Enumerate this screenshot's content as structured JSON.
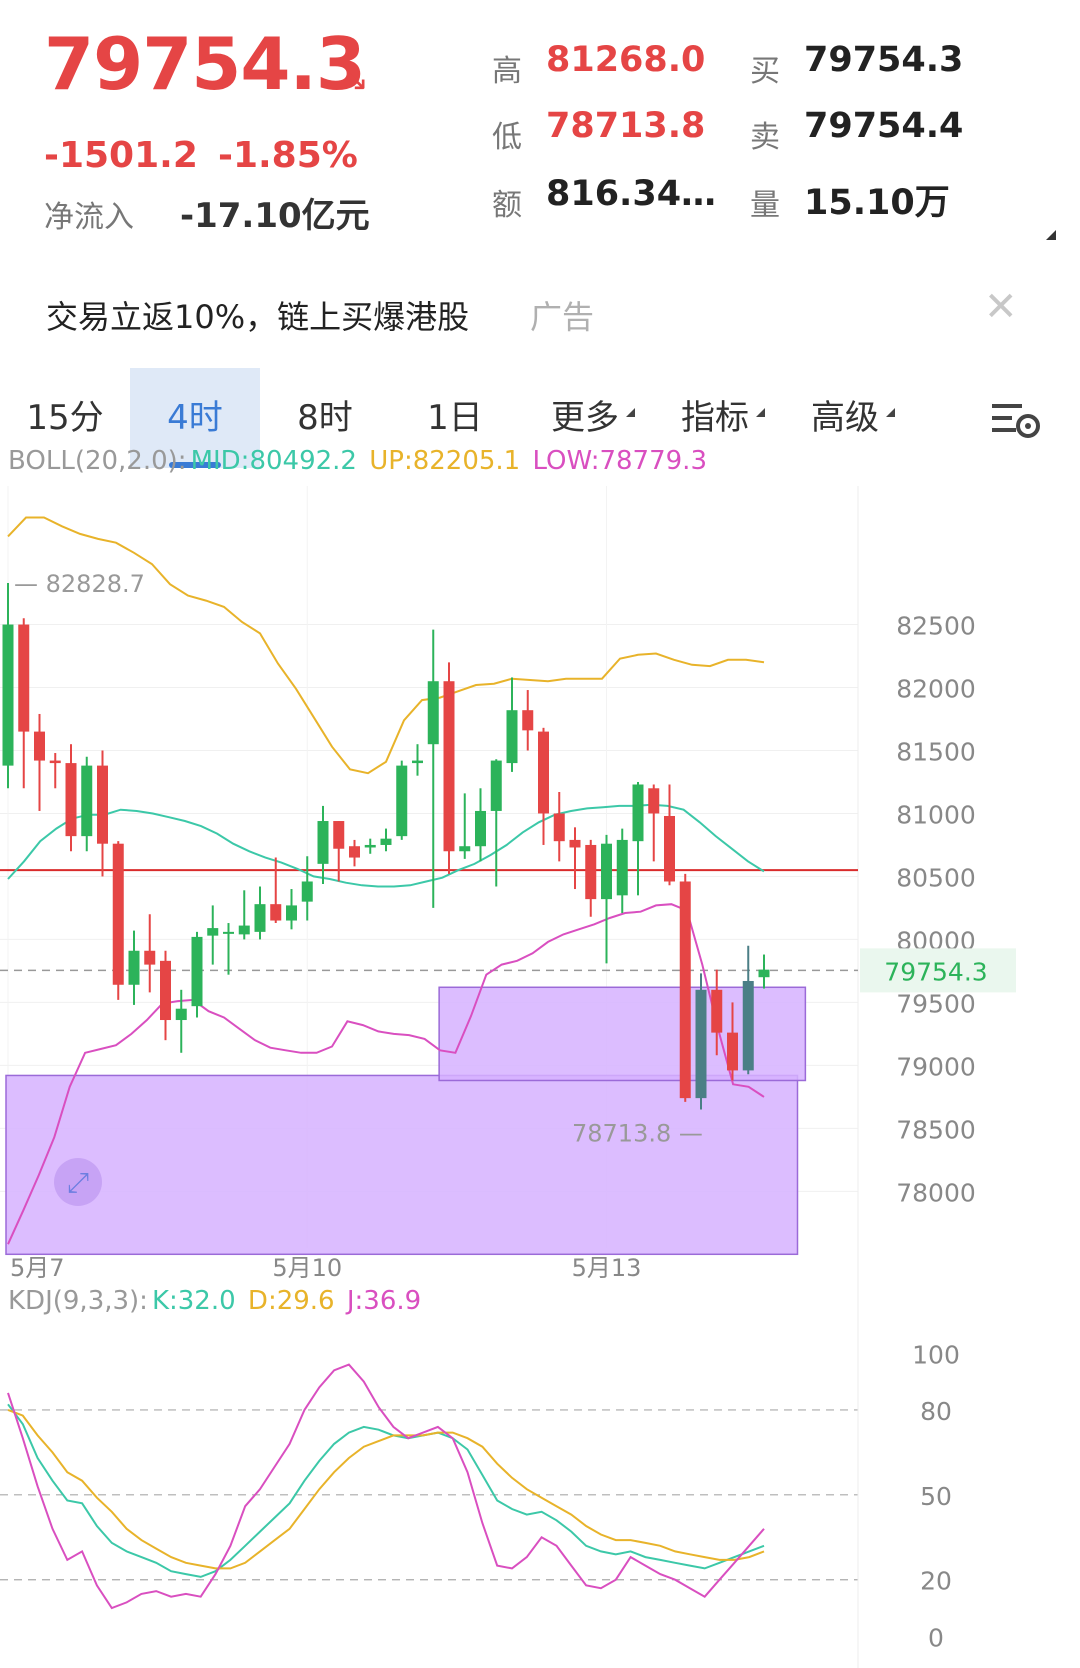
{
  "quote": {
    "price": "79754.3",
    "change": "-1501.2",
    "change_pct": "-1.85%",
    "net_inflow_label": "净流入",
    "net_inflow_value": "-17.10亿元",
    "high_label": "高",
    "high_value": "81268.0",
    "low_label": "低",
    "low_value": "78713.8",
    "amount_label": "额",
    "amount_value": "816.34…",
    "bid_label": "买",
    "bid_value": "79754.3",
    "ask_label": "卖",
    "ask_value": "79754.4",
    "volume_label": "量",
    "volume_value": "15.10万"
  },
  "ad": {
    "text": "交易立返10%，链上买爆港股",
    "tag": "广告"
  },
  "tabs": [
    {
      "label": "15分"
    },
    {
      "label": "4时"
    },
    {
      "label": "8时"
    },
    {
      "label": "1日"
    },
    {
      "label": "更多"
    },
    {
      "label": "指标"
    },
    {
      "label": "高级"
    }
  ],
  "boll_legend": {
    "name": "BOLL(20,2.0):",
    "mid": "MID:80492.2",
    "up": "UP:82205.1",
    "low": "LOW:78779.3"
  },
  "kdj_legend": {
    "name": "KDJ(9,3,3):",
    "k": "K:32.0",
    "d": "D:29.6",
    "j": "J:36.9"
  },
  "colors": {
    "up": "#2cb35a",
    "down": "#e54545",
    "mid": "#3cc8a8",
    "upper": "#e8b32a",
    "lower": "#d94fc0",
    "zone": "#d6b2ff",
    "teal": "#4b7f86"
  },
  "chart_data": [
    {
      "type": "candlestick",
      "title": "",
      "y_ticks": [
        82500,
        82000,
        81500,
        81000,
        80500,
        80000,
        79500,
        79000,
        78500,
        78000
      ],
      "x_labels": [
        "5月7",
        "5月10",
        "5月13"
      ],
      "ylim": [
        77550,
        83600
      ],
      "current_price_label": "79754.3",
      "current_price": 79754.3,
      "max_label": "82828.7",
      "min_label": "78713.8",
      "horizontal_line": 80550,
      "zones": [
        {
          "from_index": 0,
          "to_index": 50,
          "top": 78920,
          "bottom": 77500
        },
        {
          "from_index": 27.5,
          "to_index": 50.5,
          "top": 79620,
          "bottom": 78880
        }
      ],
      "candles": [
        {
          "o": 81380,
          "c": 82500,
          "h": 82830,
          "l": 81200
        },
        {
          "o": 82500,
          "c": 81650,
          "h": 82550,
          "l": 81200
        },
        {
          "o": 81650,
          "c": 81420,
          "h": 81790,
          "l": 81020
        },
        {
          "o": 81420,
          "c": 81400,
          "h": 81480,
          "l": 81200
        },
        {
          "o": 81400,
          "c": 80820,
          "h": 81550,
          "l": 80700
        },
        {
          "o": 80820,
          "c": 81380,
          "h": 81450,
          "l": 80700
        },
        {
          "o": 81380,
          "c": 80760,
          "h": 81500,
          "l": 80500
        },
        {
          "o": 80760,
          "c": 79640,
          "h": 80780,
          "l": 79520
        },
        {
          "o": 79640,
          "c": 79910,
          "h": 80070,
          "l": 79480
        },
        {
          "o": 79910,
          "c": 79800,
          "h": 80200,
          "l": 79580
        },
        {
          "o": 79830,
          "c": 79360,
          "h": 79910,
          "l": 79200
        },
        {
          "o": 79360,
          "c": 79450,
          "h": 79600,
          "l": 79100
        },
        {
          "o": 79470,
          "c": 80020,
          "h": 80060,
          "l": 79380
        },
        {
          "o": 80030,
          "c": 80090,
          "h": 80270,
          "l": 79800
        },
        {
          "o": 80060,
          "c": 80060,
          "h": 80130,
          "l": 79720
        },
        {
          "o": 80040,
          "c": 80110,
          "h": 80390,
          "l": 80000
        },
        {
          "o": 80060,
          "c": 80280,
          "h": 80420,
          "l": 80000
        },
        {
          "o": 80280,
          "c": 80150,
          "h": 80650,
          "l": 80130
        },
        {
          "o": 80150,
          "c": 80270,
          "h": 80400,
          "l": 80080
        },
        {
          "o": 80300,
          "c": 80460,
          "h": 80660,
          "l": 80150
        },
        {
          "o": 80600,
          "c": 80940,
          "h": 81060,
          "l": 80440
        },
        {
          "o": 80940,
          "c": 80720,
          "h": 80940,
          "l": 80460
        },
        {
          "o": 80740,
          "c": 80650,
          "h": 80790,
          "l": 80580
        },
        {
          "o": 80730,
          "c": 80750,
          "h": 80800,
          "l": 80680
        },
        {
          "o": 80750,
          "c": 80800,
          "h": 80880,
          "l": 80700
        },
        {
          "o": 80820,
          "c": 81380,
          "h": 81420,
          "l": 80790
        },
        {
          "o": 81400,
          "c": 81420,
          "h": 81550,
          "l": 81300
        },
        {
          "o": 81550,
          "c": 82050,
          "h": 82460,
          "l": 80250
        },
        {
          "o": 82050,
          "c": 80700,
          "h": 82200,
          "l": 80520
        },
        {
          "o": 80700,
          "c": 80740,
          "h": 81160,
          "l": 80640
        },
        {
          "o": 80740,
          "c": 81020,
          "h": 81200,
          "l": 80620
        },
        {
          "o": 81020,
          "c": 81420,
          "h": 81430,
          "l": 80420
        },
        {
          "o": 81400,
          "c": 81820,
          "h": 82080,
          "l": 81330
        },
        {
          "o": 81820,
          "c": 81660,
          "h": 81980,
          "l": 81500
        },
        {
          "o": 81650,
          "c": 81000,
          "h": 81680,
          "l": 80750
        },
        {
          "o": 81000,
          "c": 80780,
          "h": 81170,
          "l": 80620
        },
        {
          "o": 80790,
          "c": 80730,
          "h": 80890,
          "l": 80400
        },
        {
          "o": 80750,
          "c": 80320,
          "h": 80790,
          "l": 80180
        },
        {
          "o": 80320,
          "c": 80760,
          "h": 80830,
          "l": 79810
        },
        {
          "o": 80350,
          "c": 80790,
          "h": 80880,
          "l": 80210
        },
        {
          "o": 80780,
          "c": 81230,
          "h": 81250,
          "l": 80350
        },
        {
          "o": 81200,
          "c": 81000,
          "h": 81230,
          "l": 80620
        },
        {
          "o": 80980,
          "c": 80460,
          "h": 81230,
          "l": 80430
        },
        {
          "o": 80460,
          "c": 78740,
          "h": 80520,
          "l": 78710
        },
        {
          "o": 78740,
          "c": 79600,
          "h": 79730,
          "l": 78650
        },
        {
          "o": 79600,
          "c": 79260,
          "h": 79760,
          "l": 79080
        },
        {
          "o": 79260,
          "c": 78960,
          "h": 79500,
          "l": 78880
        },
        {
          "o": 78960,
          "c": 79670,
          "h": 79950,
          "l": 78930
        },
        {
          "o": 79700,
          "c": 79760,
          "h": 79880,
          "l": 79610
        }
      ],
      "boll_mid": [
        80480,
        80620,
        80780,
        80880,
        80960,
        80990,
        80990,
        81030,
        81020,
        81000,
        80970,
        80940,
        80900,
        80840,
        80760,
        80700,
        80650,
        80610,
        80560,
        80500,
        80480,
        80450,
        80430,
        80420,
        80420,
        80430,
        80460,
        80490,
        80550,
        80600,
        80670,
        80750,
        80850,
        80930,
        80990,
        81020,
        81040,
        81050,
        81060,
        81060,
        81070,
        81060,
        81030,
        80930,
        80820,
        80720,
        80620,
        80540
      ],
      "boll_upper": [
        83200,
        83350,
        83350,
        83280,
        83220,
        83180,
        83150,
        83070,
        82980,
        82820,
        82730,
        82690,
        82640,
        82520,
        82430,
        82190,
        81990,
        81760,
        81530,
        81350,
        81320,
        81410,
        81740,
        81900,
        81920,
        81970,
        82020,
        82030,
        82070,
        82060,
        82050,
        82070,
        82070,
        82070,
        82230,
        82260,
        82270,
        82220,
        82180,
        82170,
        82220,
        82220,
        82200
      ],
      "boll_lower": [
        77580,
        77850,
        78130,
        78430,
        78830,
        79100,
        79130,
        79160,
        79250,
        79360,
        79490,
        79510,
        79520,
        79430,
        79380,
        79290,
        79200,
        79140,
        79120,
        79100,
        79100,
        79150,
        79350,
        79320,
        79270,
        79250,
        79240,
        79210,
        79120,
        79100,
        79390,
        79720,
        79800,
        79830,
        79890,
        79980,
        80040,
        80080,
        80120,
        80170,
        80210,
        80220,
        80270,
        80280,
        80230,
        79800,
        79300,
        78850,
        78830,
        78750
      ],
      "boll_lower_index_scale": "lower series index 0..49 maps to candle 0..48",
      "boll_mid_upper_index_scale": "mid series index 0..47 and upper series index 0..42 map to candle 0..48"
    },
    {
      "type": "line",
      "title": "",
      "y_ticks": [
        100,
        80,
        50,
        20,
        0
      ],
      "ylim": [
        -2,
        104
      ],
      "series": [
        {
          "name": "K",
          "values": [
            82,
            75,
            63,
            55,
            48,
            47,
            39,
            33,
            30,
            28,
            26,
            23,
            22,
            21,
            23,
            27,
            32,
            37,
            42,
            47,
            55,
            62,
            68,
            72,
            74,
            73,
            71,
            70,
            71,
            72,
            70,
            66,
            57,
            48,
            45,
            43,
            44,
            41,
            37,
            32,
            30,
            29,
            30,
            28,
            27,
            26,
            25,
            24,
            26,
            28,
            30,
            32
          ]
        },
        {
          "name": "D",
          "values": [
            80,
            78,
            71,
            65,
            58,
            55,
            49,
            44,
            38,
            34,
            31,
            28,
            26,
            25,
            24,
            24,
            26,
            30,
            34,
            38,
            45,
            52,
            58,
            63,
            67,
            69,
            71,
            71,
            71,
            72,
            72,
            70,
            67,
            61,
            56,
            52,
            49,
            46,
            43,
            39,
            36,
            34,
            34,
            33,
            32,
            30,
            29,
            28,
            27,
            27,
            28,
            30
          ]
        },
        {
          "name": "J",
          "values": [
            86,
            70,
            53,
            38,
            27,
            30,
            18,
            10,
            12,
            15,
            16,
            14,
            15,
            14,
            22,
            32,
            46,
            52,
            60,
            68,
            80,
            88,
            94,
            96,
            90,
            81,
            74,
            70,
            72,
            74,
            70,
            58,
            40,
            25,
            24,
            28,
            35,
            32,
            25,
            18,
            17,
            20,
            28,
            25,
            22,
            20,
            17,
            14,
            20,
            26,
            32,
            38
          ]
        }
      ]
    }
  ]
}
